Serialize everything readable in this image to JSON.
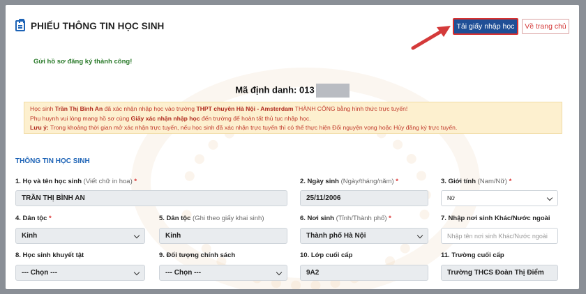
{
  "header": {
    "title": "PHIẾU THÔNG TIN HỌC SINH"
  },
  "actions": {
    "download_label": "Tải giấy nhập học",
    "home_label": "Về trang chủ"
  },
  "success_message": "Gửi hồ sơ đăng ký thành công!",
  "student_id": {
    "label": "Mã định danh:",
    "value": "013"
  },
  "notice": {
    "line1_pre": "Học sinh ",
    "line1_name": "Trần Thị Bình An",
    "line1_mid": " đã xác nhận nhập học vào trường ",
    "line1_school": "THPT chuyên Hà Nội - Amsterdam",
    "line1_post": " THÀNH CÔNG bằng hình thức trực tuyến!",
    "line2_pre": "Phụ huynh vui lòng mang hồ sơ cùng ",
    "line2_doc": "Giấy xác nhận nhập học",
    "line2_post": " đến trường để hoàn tất thủ tục nhập học.",
    "line3_label": "Lưu ý:",
    "line3_text": " Trong khoảng thời gian mở xác nhận trực tuyến, nếu học sinh đã xác nhận trực tuyến thì có thể thực hiện Đổi nguyện vọng hoặc Hủy đăng ký trực tuyến."
  },
  "section_title": "THÔNG TIN HỌC SINH",
  "fields": {
    "f1": {
      "label": "1. Họ và tên học sinh",
      "hint": " (Viết chữ in hoa)",
      "req": " *",
      "value": "TRẦN THỊ BÌNH AN"
    },
    "f2": {
      "label": "2. Ngày sinh",
      "hint": " (Ngày/tháng/năm)",
      "req": " *",
      "value": "25/11/2006"
    },
    "f3": {
      "label": "3. Giới tính",
      "hint": " (Nam/Nữ)",
      "req": " *",
      "value": "Nữ"
    },
    "f4": {
      "label": "4. Dân tộc",
      "req": " *",
      "value": "Kinh"
    },
    "f5": {
      "label": "5. Dân tộc",
      "hint": " (Ghi theo giấy khai sinh)",
      "value": "Kinh"
    },
    "f6": {
      "label": "6. Nơi sinh",
      "hint": " (Tỉnh/Thành phố)",
      "req": " *",
      "value": "Thành phố Hà Nội"
    },
    "f7": {
      "label": "7. Nhập nơi sinh Khác/Nước ngoài",
      "placeholder": "Nhập tên nơi sinh Khác/Nước ngoài"
    },
    "f8": {
      "label": "8. Học sinh khuyết tật",
      "value": "--- Chọn ---"
    },
    "f9": {
      "label": "9. Đối tượng chính sách",
      "value": "--- Chọn ---"
    },
    "f10": {
      "label": "10. Lớp cuối cấp",
      "value": "9A2"
    },
    "f11": {
      "label": "11. Trường cuối cấp",
      "value": "Trường THCS Đoàn Thị Điểm"
    }
  }
}
